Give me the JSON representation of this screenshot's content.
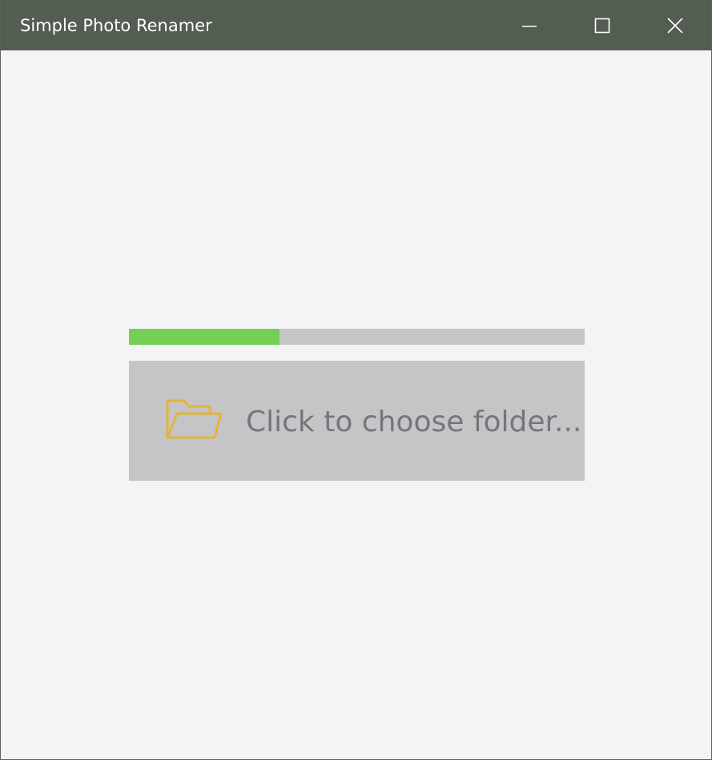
{
  "window": {
    "title": "Simple Photo Renamer",
    "controls": [
      {
        "name": "minimize",
        "icon": "minimize-icon"
      },
      {
        "name": "maximize",
        "icon": "maximize-icon"
      },
      {
        "name": "close",
        "icon": "close-icon"
      }
    ]
  },
  "main": {
    "progress": {
      "value": 0.33,
      "fill_color": "#74d054",
      "track_color": "#c5c5c7"
    },
    "choose_folder": {
      "label": "Click to choose folder...",
      "icon": "folder-open-icon",
      "icon_color": "#e3b43b",
      "background": "#c5c5c7"
    }
  },
  "colors": {
    "titlebar": "#535d52",
    "background": "#f4f4f6"
  }
}
